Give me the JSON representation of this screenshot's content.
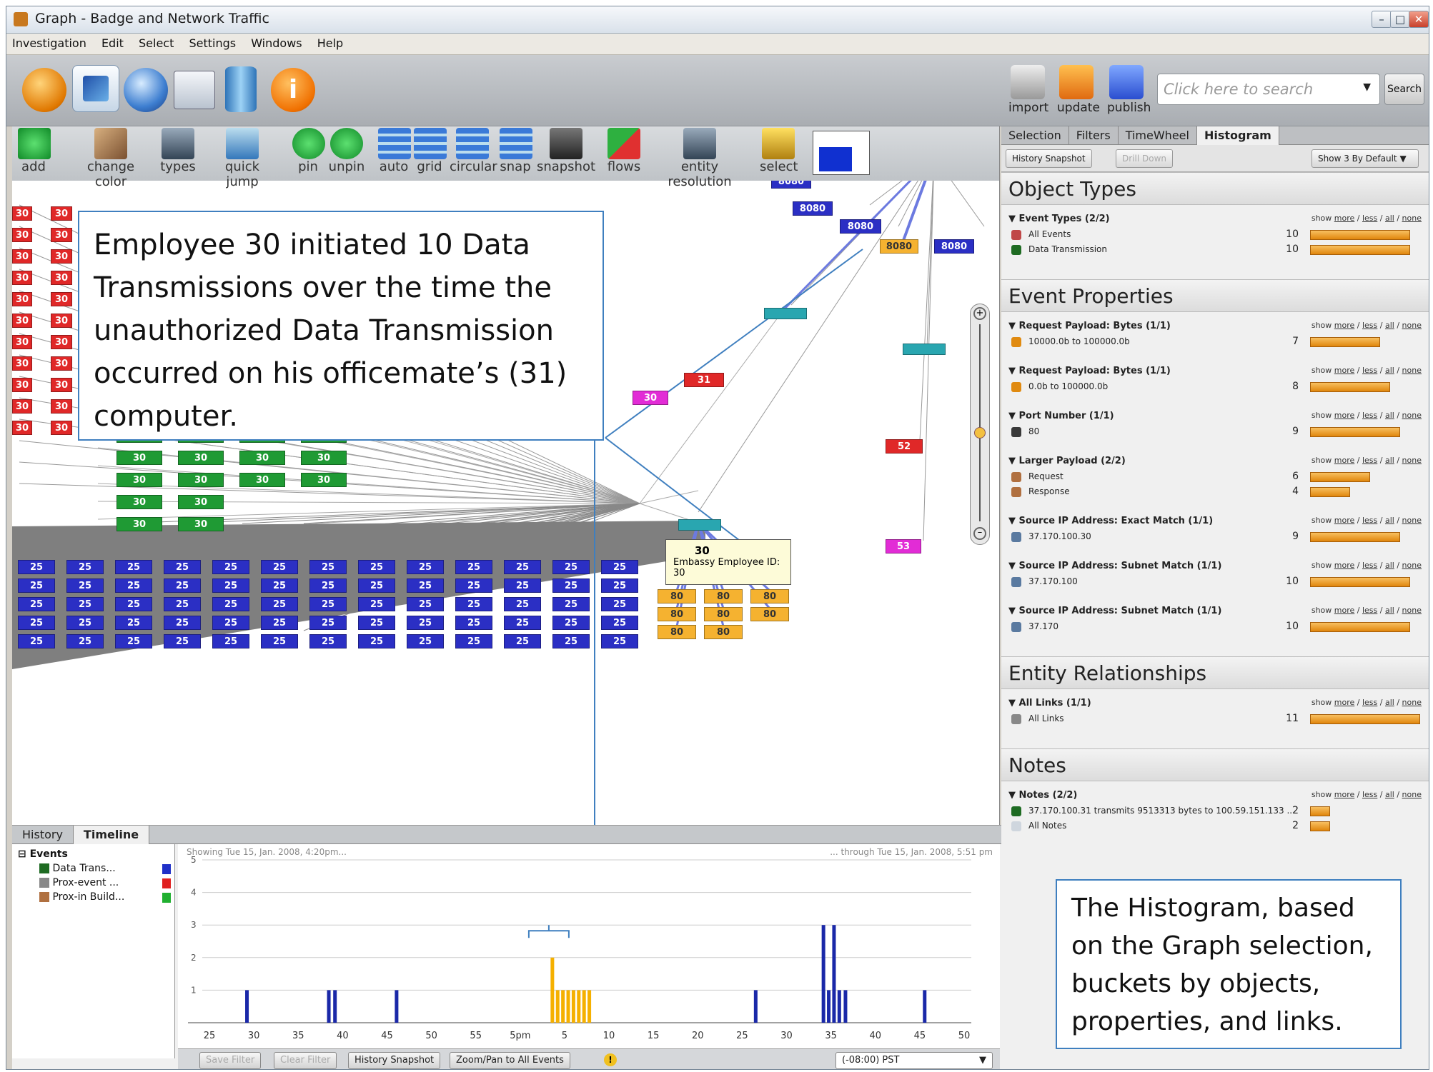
{
  "window": {
    "title": "Graph - Badge and Network Traffic"
  },
  "menu": [
    "Investigation",
    "Edit",
    "Select",
    "Settings",
    "Windows",
    "Help"
  ],
  "toolbar_right": {
    "import": "import",
    "update": "update",
    "publish": "publish",
    "search_placeholder": "Click here to search",
    "search_button": "Search"
  },
  "graph_tools": [
    "add",
    "change color",
    "types",
    "quick jump",
    "pin",
    "unpin",
    "auto",
    "grid",
    "circular",
    "snap",
    "snapshot",
    "flows",
    "entity resolution",
    "select"
  ],
  "callout_left": "Employee 30 initiated 10 Data Transmissions over the time the unauthorized Data Transmission occurred on his officemate’s (31) computer.",
  "callout_right": "The Histogram, based on the Graph selection, buckets by objects, properties, and links.",
  "tooltip": {
    "id": "30",
    "desc": "Embassy Employee ID: 30"
  },
  "node_labels": {
    "n30": "30",
    "n31": "31",
    "n52": "52",
    "n53": "53",
    "p8080": "8080",
    "p80": "80",
    "n25": "25"
  },
  "right_tabs": [
    "Selection",
    "Filters",
    "TimeWheel",
    "Histogram"
  ],
  "right_toolbar": {
    "snapshot": "History Snapshot",
    "drill": "Drill Down",
    "show": "Show 3 By Default"
  },
  "show_links": {
    "show": "show",
    "more": "more",
    "less": "less",
    "all": "all",
    "none": "none"
  },
  "histogram": {
    "sections": [
      {
        "title": "Object Types",
        "groups": [
          {
            "name": "Event Types (2/2)",
            "rows": [
              {
                "label": "All Events",
                "count": 10,
                "color": "#c04848"
              },
              {
                "label": "Data Transmission",
                "count": 10,
                "color": "#1e6b22"
              }
            ]
          }
        ]
      },
      {
        "title": "Event Properties",
        "groups": [
          {
            "name": "Request Payload: Bytes (1/1)",
            "rows": [
              {
                "label": "10000.0b to 100000.0b",
                "count": 7,
                "color": "#e08a10"
              }
            ]
          },
          {
            "name": "Request Payload: Bytes (1/1)",
            "rows": [
              {
                "label": "0.0b to 100000.0b",
                "count": 8,
                "color": "#e08a10"
              }
            ]
          },
          {
            "name": "Port Number (1/1)",
            "rows": [
              {
                "label": "80",
                "count": 9,
                "color": "#3a3a3a"
              }
            ]
          },
          {
            "name": "Larger Payload (2/2)",
            "rows": [
              {
                "label": "Request",
                "count": 6,
                "color": "#b07040"
              },
              {
                "label": "Response",
                "count": 4,
                "color": "#b07040"
              }
            ]
          },
          {
            "name": "Source IP Address: Exact Match (1/1)",
            "rows": [
              {
                "label": "37.170.100.30",
                "count": 9,
                "color": "#5a7aa0"
              }
            ]
          },
          {
            "name": "Source IP Address: Subnet Match (1/1)",
            "rows": [
              {
                "label": "37.170.100",
                "count": 10,
                "color": "#5a7aa0"
              }
            ]
          },
          {
            "name": "Source IP Address: Subnet Match (1/1)",
            "rows": [
              {
                "label": "37.170",
                "count": 10,
                "color": "#5a7aa0"
              }
            ]
          }
        ]
      },
      {
        "title": "Entity Relationships",
        "groups": [
          {
            "name": "All Links (1/1)",
            "rows": [
              {
                "label": "All Links",
                "count": 11,
                "color": "#888888"
              }
            ]
          }
        ]
      },
      {
        "title": "Notes",
        "groups": [
          {
            "name": "Notes (2/2)",
            "rows": [
              {
                "label": "37.170.100.31 transmits 9513313 bytes to 100.59.151.133 ...",
                "count": 2,
                "color": "#1e6b22"
              },
              {
                "label": "All Notes",
                "count": 2,
                "color": "#cfd6de"
              }
            ]
          }
        ]
      }
    ]
  },
  "bottom_tabs": [
    "History",
    "Timeline"
  ],
  "tree": {
    "root": "Events",
    "items": [
      {
        "label": "Data Trans...",
        "color": "#2030c8"
      },
      {
        "label": "Prox-event ...",
        "color": "#e02020"
      },
      {
        "label": "Prox-in Build...",
        "color": "#20b030"
      }
    ]
  },
  "timeline": {
    "showing": "Showing Tue 15, Jan. 2008, 4:20pm...",
    "through": "... through Tue 15, Jan. 2008, 5:51 pm",
    "xmark": "5pm"
  },
  "bottom_bar": {
    "save": "Save Filter",
    "clear": "Clear Filter",
    "snapshot": "History Snapshot",
    "zoom": "Zoom/Pan to All Events",
    "tz": "(-08:00) PST"
  },
  "chart_data": {
    "type": "bar",
    "title": "",
    "ylim": [
      0,
      5
    ],
    "yticks": [
      1,
      2,
      3,
      4,
      5
    ],
    "xticks": [
      "25",
      "30",
      "35",
      "40",
      "45",
      "50",
      "55",
      "5pm",
      "5",
      "10",
      "15",
      "20",
      "25",
      "30",
      "35",
      "40",
      "45",
      "50"
    ],
    "series": [
      {
        "color": "#1a28a8",
        "x": [
          28.5,
          37.8,
          38.5,
          45.5,
          86.3,
          94,
          94.6,
          95.2,
          95.8,
          96.5,
          105.5
        ],
        "values": [
          1,
          1,
          1,
          1,
          1,
          3,
          1,
          3,
          1,
          1,
          1
        ]
      },
      {
        "color": "#f5b000",
        "x": [
          63.2,
          63.8,
          64.4,
          65,
          65.6,
          66.2,
          66.8,
          67.4
        ],
        "values": [
          2,
          1,
          1,
          1,
          1,
          1,
          1,
          1
        ]
      }
    ]
  }
}
